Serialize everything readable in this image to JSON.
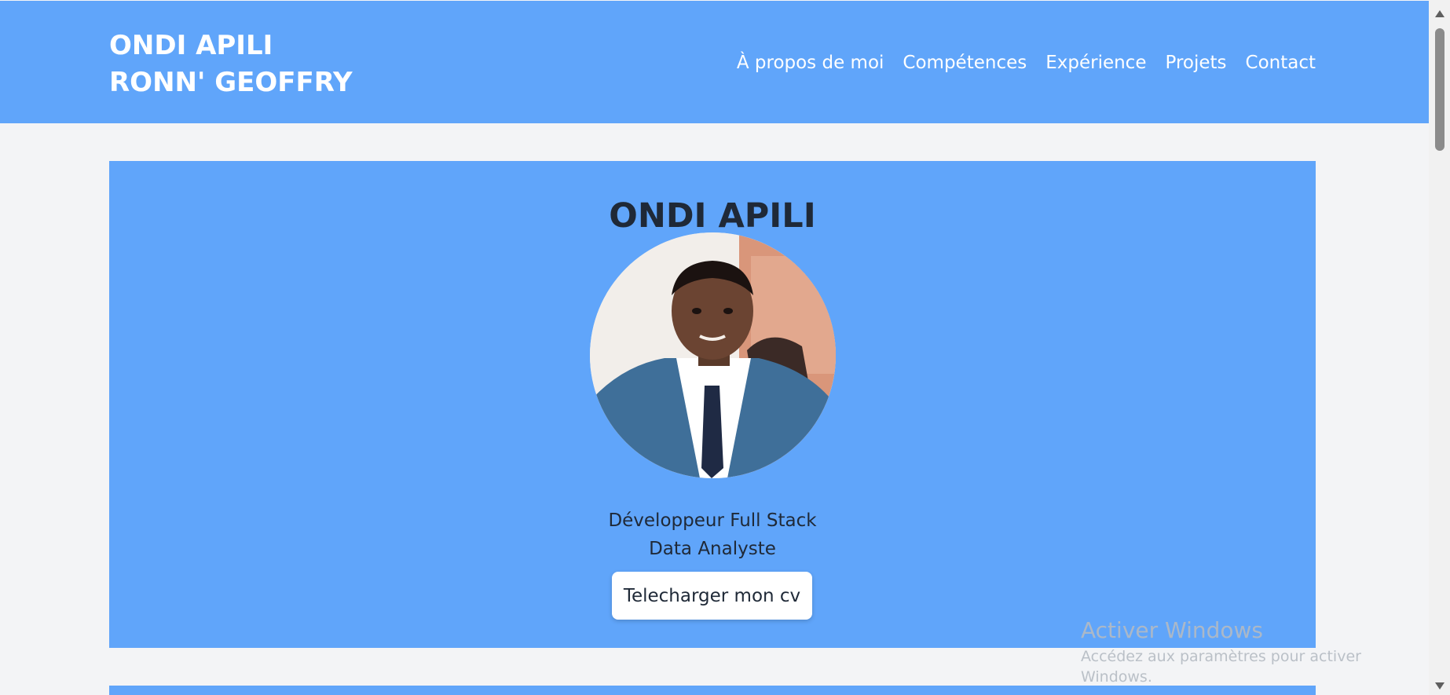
{
  "header": {
    "brand_line1": "ONDI APILI",
    "brand_line2": "RONN' GEOFFRY",
    "nav": [
      {
        "label": "À propos de moi"
      },
      {
        "label": "Compétences"
      },
      {
        "label": "Expérience"
      },
      {
        "label": "Projets"
      },
      {
        "label": "Contact"
      }
    ]
  },
  "hero": {
    "name": "ONDI APILI",
    "role_line1": "Développeur Full Stack",
    "role_line2": "Data Analyste",
    "cv_button": "Telecharger mon cv"
  },
  "watermark": {
    "title": "Activer Windows",
    "subtitle": "Accédez aux paramètres pour activer Windows."
  },
  "colors": {
    "accent": "#60a5fa",
    "page_bg": "#f3f4f6",
    "text_dark": "#1f2937"
  }
}
